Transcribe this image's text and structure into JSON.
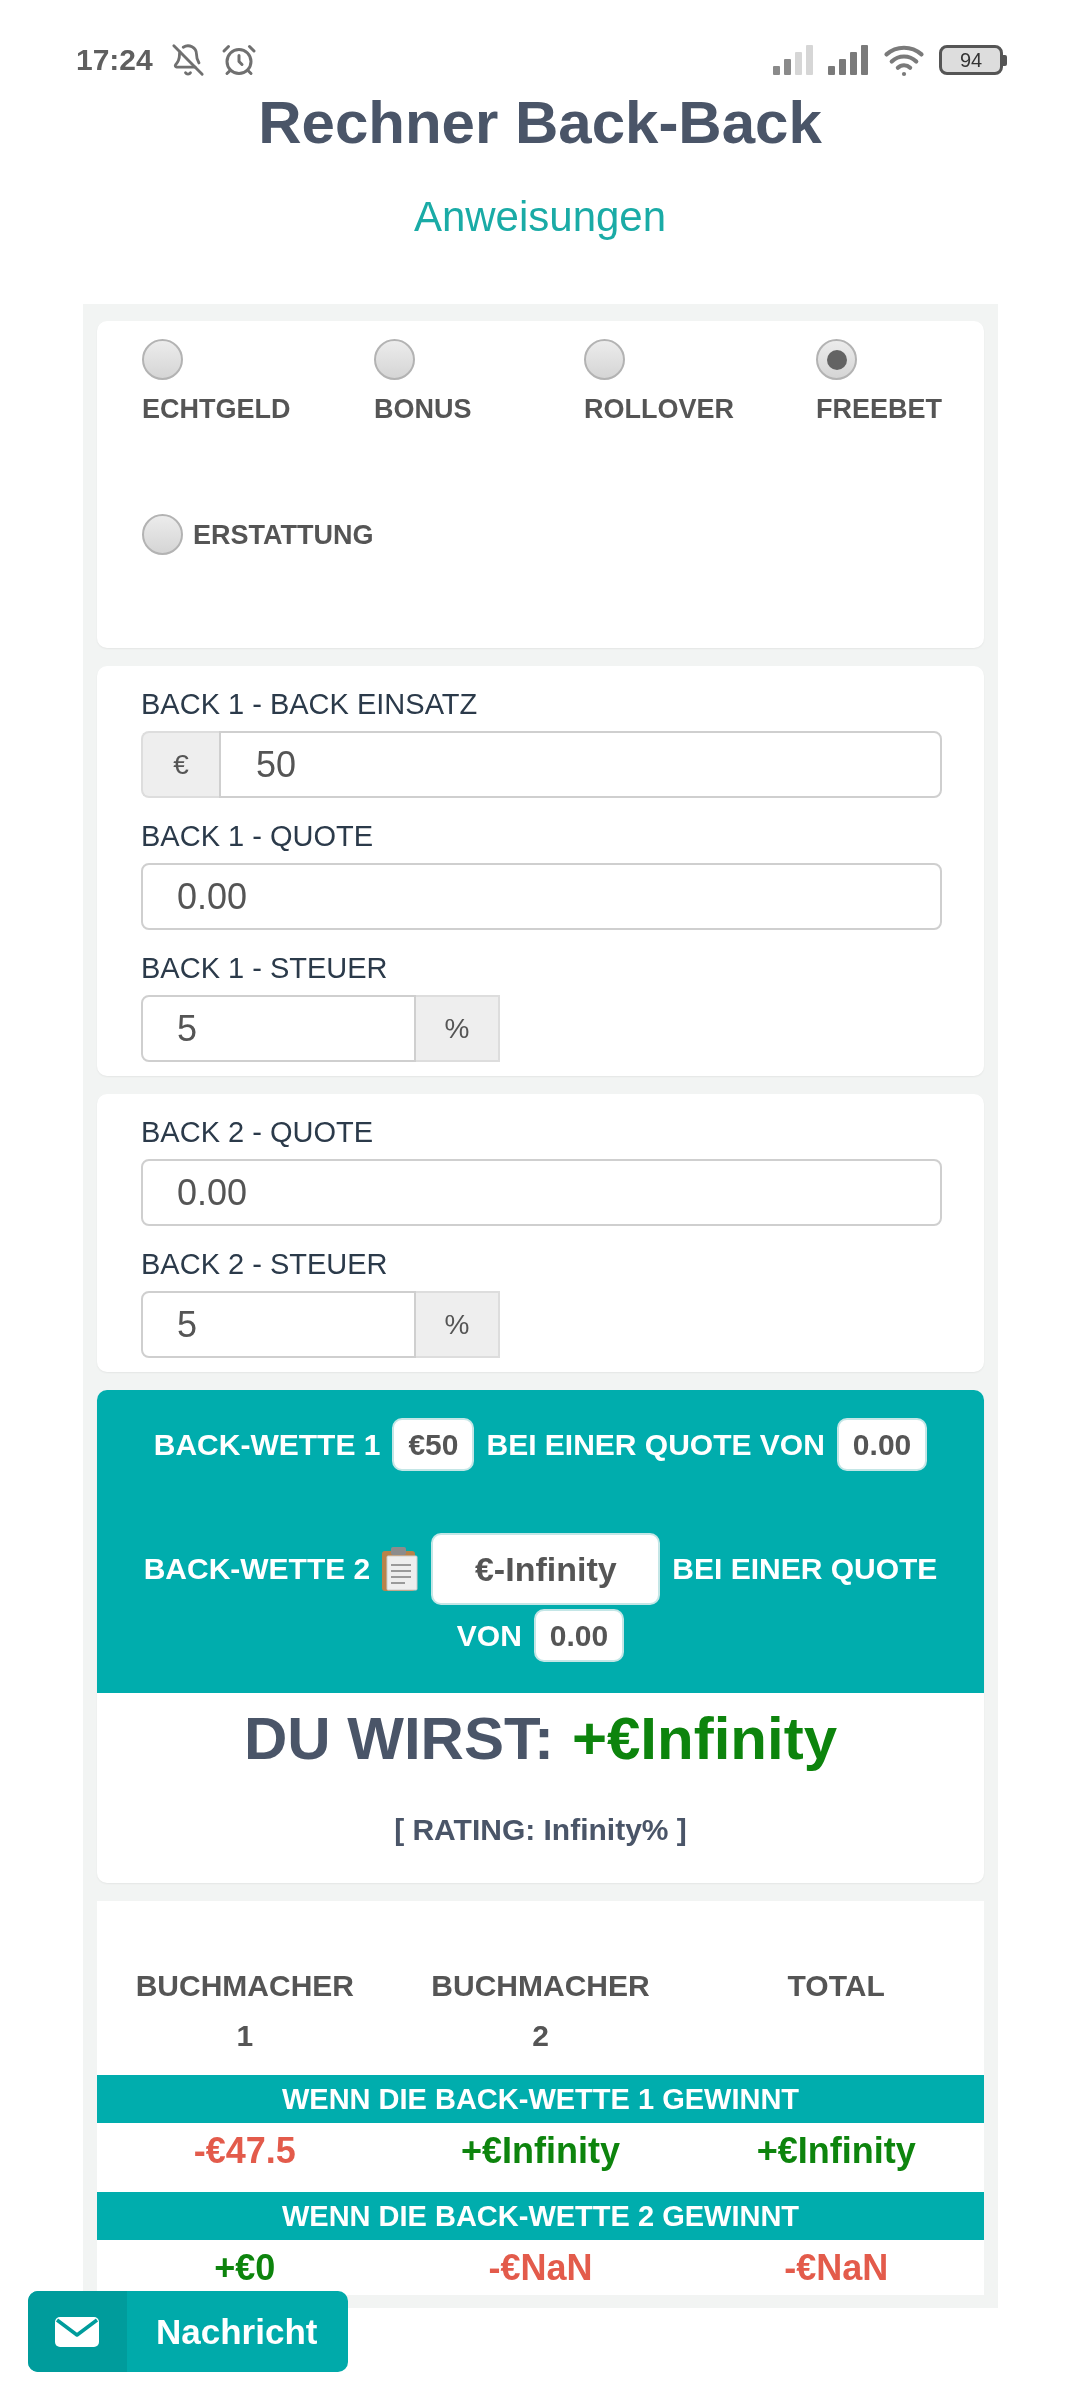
{
  "status_bar": {
    "time": "17:24",
    "battery": "94"
  },
  "title": "Rechner Back-Back",
  "instructions_link": "Anweisungen",
  "bet_types": [
    {
      "label": "ECHTGELD",
      "kind": "stacked",
      "selected": false
    },
    {
      "label": "BONUS",
      "kind": "stacked",
      "selected": false
    },
    {
      "label": "ROLLOVER",
      "kind": "stacked",
      "selected": false
    },
    {
      "label": "FREEBET",
      "kind": "stacked",
      "selected": true
    },
    {
      "label": "ERSTATTUNG",
      "kind": "inline",
      "selected": false
    }
  ],
  "back1": {
    "fields": [
      {
        "label": "BACK 1 - BACK EINSATZ",
        "prefix": "€",
        "value": "50"
      },
      {
        "label": "BACK 1 - QUOTE",
        "value": "0.00"
      },
      {
        "label": "BACK 1 - STEUER",
        "value": "5",
        "suffix": "%"
      }
    ]
  },
  "back2": {
    "fields": [
      {
        "label": "BACK 2 - QUOTE",
        "value": "0.00"
      },
      {
        "label": "BACK 2 - STEUER",
        "value": "5",
        "suffix": "%"
      }
    ]
  },
  "summary": {
    "lines": [
      {
        "parts": [
          {
            "kind": "text",
            "text": "BACK-WETTE 1"
          },
          {
            "kind": "value",
            "text": "€50"
          },
          {
            "kind": "text",
            "text": "BEI EINER QUOTE VON"
          },
          {
            "kind": "value",
            "text": "0.00"
          }
        ]
      },
      {
        "parts": [
          {
            "kind": "text",
            "text": "BACK-WETTE 2"
          },
          {
            "kind": "field",
            "value": "€-Infinity",
            "copy_button": true
          },
          {
            "kind": "text",
            "text": "BEI EINER QUOTE"
          },
          {
            "kind": "text",
            "text": "VON"
          },
          {
            "kind": "value",
            "text": "0.00"
          }
        ]
      }
    ],
    "result_label": "DU WIRST:",
    "result_value": "+€Infinity",
    "rating": "[ RATING: Infinity% ]"
  },
  "results": {
    "columns": [
      "BUCHMACHER 1",
      "BUCHMACHER 2",
      "TOTAL"
    ],
    "sections": [
      {
        "title": "WENN DIE BACK-WETTE 1 GEWINNT",
        "cells": [
          {
            "text": "-€47.5",
            "color": "#e35b4b"
          },
          {
            "text": "+€Infinity",
            "color": "#0d840d"
          },
          {
            "text": "+€Infinity",
            "color": "#0d840d"
          }
        ]
      },
      {
        "title": "WENN DIE BACK-WETTE 2 GEWINNT",
        "cells": [
          {
            "text": "+€0",
            "color": "#0d840d"
          },
          {
            "text": "-€NaN",
            "color": "#e35b4b"
          },
          {
            "text": "-€NaN",
            "color": "#e35b4b"
          }
        ]
      }
    ]
  },
  "message_button": {
    "label": "Nachricht"
  }
}
